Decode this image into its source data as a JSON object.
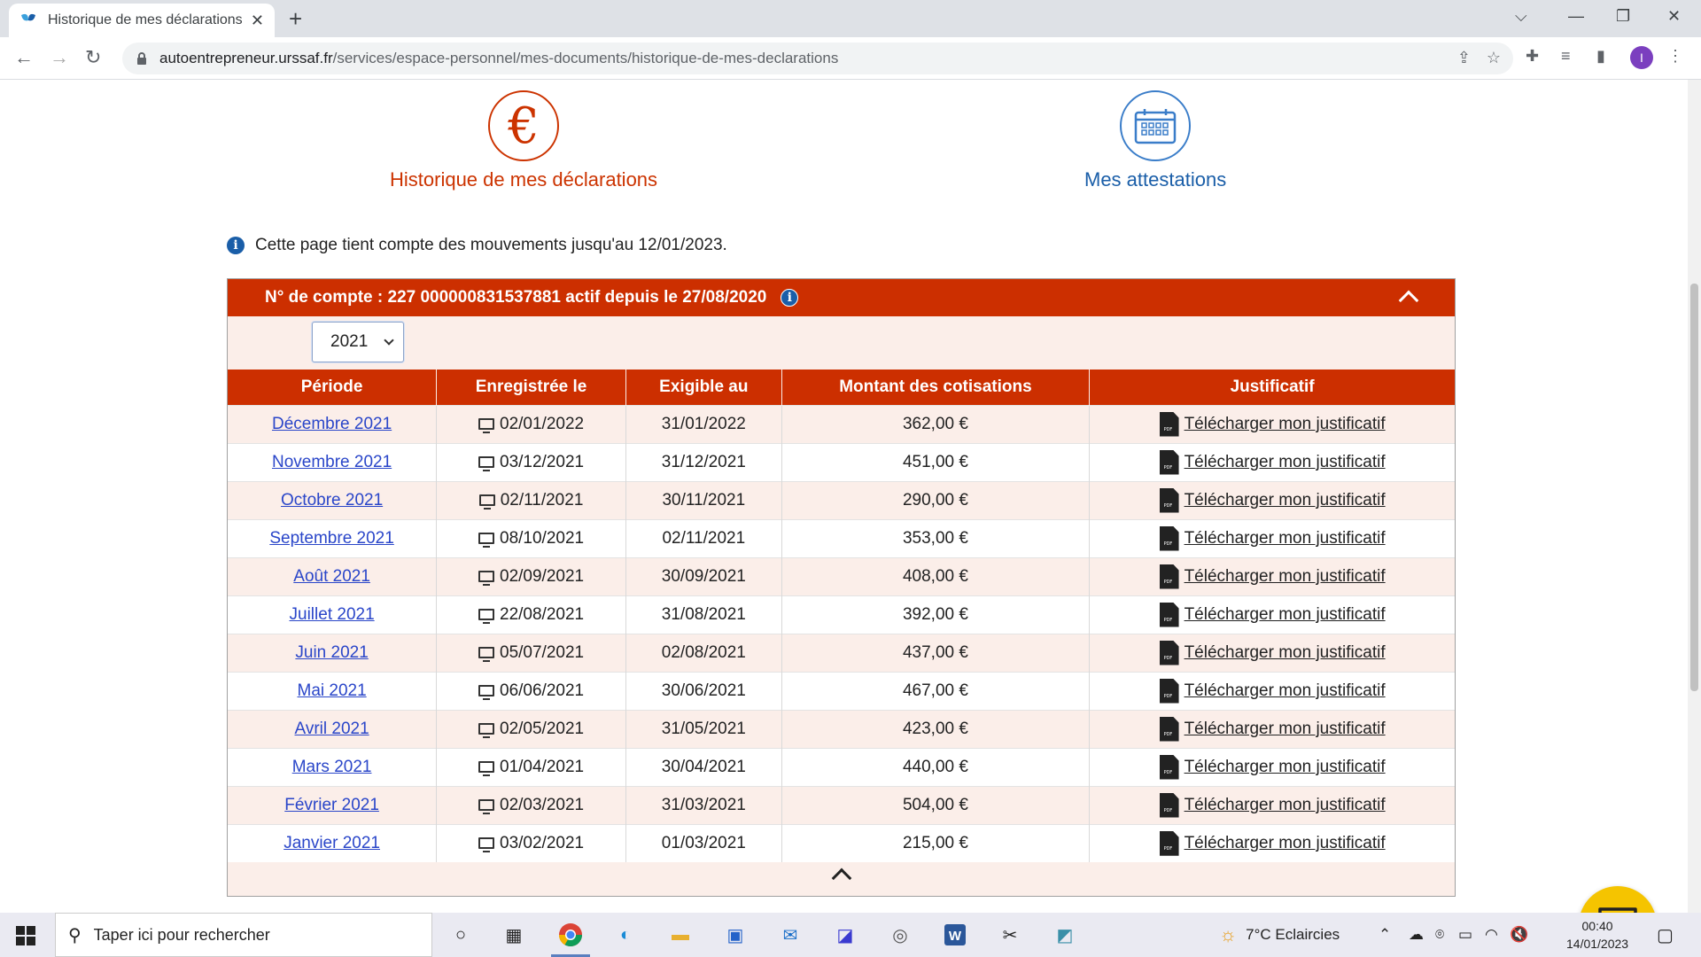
{
  "browser": {
    "tab_title": "Historique de mes déclarations -",
    "url_host": "autoentrepreneur.urssaf.fr",
    "url_path": "/services/espace-personnel/mes-documents/historique-de-mes-declarations"
  },
  "nav": {
    "history_label": "Historique de mes déclarations",
    "attestations_label": "Mes attestations"
  },
  "info_text": "Cette page tient compte des mouvements jusqu'au 12/01/2023.",
  "account": {
    "header": "N° de compte : 227 000000831537881 actif depuis le 27/08/2020",
    "selected_year": "2021"
  },
  "table": {
    "headers": [
      "Période",
      "Enregistrée le",
      "Exigible au",
      "Montant des cotisations",
      "Justificatif"
    ],
    "download_label": "Télécharger mon justificatif",
    "rows": [
      {
        "period": "Décembre 2021",
        "registered": "02/01/2022",
        "due": "31/01/2022",
        "amount": "362,00 €"
      },
      {
        "period": "Novembre 2021",
        "registered": "03/12/2021",
        "due": "31/12/2021",
        "amount": "451,00 €"
      },
      {
        "period": "Octobre 2021",
        "registered": "02/11/2021",
        "due": "30/11/2021",
        "amount": "290,00 €"
      },
      {
        "period": "Septembre 2021",
        "registered": "08/10/2021",
        "due": "02/11/2021",
        "amount": "353,00 €"
      },
      {
        "period": "Août 2021",
        "registered": "02/09/2021",
        "due": "30/09/2021",
        "amount": "408,00 €"
      },
      {
        "period": "Juillet 2021",
        "registered": "22/08/2021",
        "due": "31/08/2021",
        "amount": "392,00 €"
      },
      {
        "period": "Juin 2021",
        "registered": "05/07/2021",
        "due": "02/08/2021",
        "amount": "437,00 €"
      },
      {
        "period": "Mai 2021",
        "registered": "06/06/2021",
        "due": "30/06/2021",
        "amount": "467,00 €"
      },
      {
        "period": "Avril 2021",
        "registered": "02/05/2021",
        "due": "31/05/2021",
        "amount": "423,00 €"
      },
      {
        "period": "Mars 2021",
        "registered": "01/04/2021",
        "due": "30/04/2021",
        "amount": "440,00 €"
      },
      {
        "period": "Février 2021",
        "registered": "02/03/2021",
        "due": "31/03/2021",
        "amount": "504,00 €"
      },
      {
        "period": "Janvier 2021",
        "registered": "03/02/2021",
        "due": "01/03/2021",
        "amount": "215,00 €"
      }
    ]
  },
  "taskbar": {
    "search_placeholder": "Taper ici pour rechercher",
    "weather": "7°C  Eclaircies",
    "time": "00:40",
    "date": "14/01/2023",
    "avatar_letter": "I"
  },
  "colors": {
    "accent_red": "#cc2f00",
    "link_blue": "#1a5ea8",
    "row_tint": "#fbeee9",
    "chat_yellow": "#f5c400"
  }
}
